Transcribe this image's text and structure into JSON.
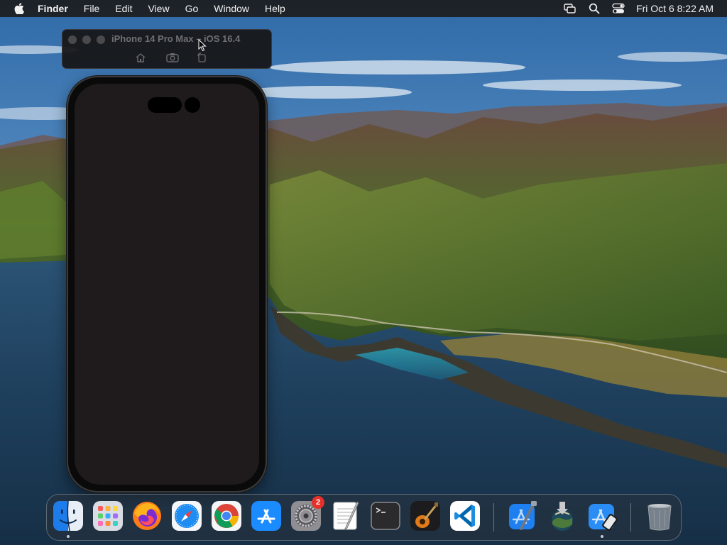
{
  "menubar": {
    "app_name": "Finder",
    "items": [
      "File",
      "Edit",
      "View",
      "Go",
      "Window",
      "Help"
    ],
    "clock": "Fri Oct 6  8:22 AM",
    "status_icons": [
      "screen-mirroring-icon",
      "spotlight-search-icon",
      "control-center-icon"
    ]
  },
  "simulator": {
    "title": "iPhone 14 Pro Max – iOS 16.4",
    "buttons": [
      "home-icon",
      "screenshot-icon",
      "rotate-icon"
    ]
  },
  "dock": {
    "apps": [
      {
        "name": "Finder",
        "icon": "finder-icon",
        "running": true
      },
      {
        "name": "Launchpad",
        "icon": "launchpad-icon",
        "running": false
      },
      {
        "name": "Firefox",
        "icon": "firefox-icon",
        "running": false
      },
      {
        "name": "Safari",
        "icon": "safari-icon",
        "running": false
      },
      {
        "name": "Google Chrome",
        "icon": "chrome-icon",
        "running": false
      },
      {
        "name": "App Store",
        "icon": "app-store-icon",
        "running": false
      },
      {
        "name": "System Settings",
        "icon": "system-settings-icon",
        "running": false,
        "badge": "2"
      },
      {
        "name": "TextEdit",
        "icon": "textedit-icon",
        "running": false
      },
      {
        "name": "Terminal",
        "icon": "terminal-icon",
        "running": false
      },
      {
        "name": "GarageBand",
        "icon": "garageband-icon",
        "running": false
      },
      {
        "name": "Visual Studio Code",
        "icon": "vscode-icon",
        "running": false
      },
      {
        "name": "Xcode",
        "icon": "xcode-icon",
        "running": false
      },
      {
        "name": "macOS Installer",
        "icon": "installer-icon",
        "running": false
      },
      {
        "name": "Simulator",
        "icon": "simulator-icon",
        "running": true
      },
      {
        "name": "Trash",
        "icon": "trash-icon",
        "running": false
      }
    ]
  },
  "colors": {
    "menubar_bg": "#1c1c1e",
    "badge": "#e5312a",
    "device_screen": "#1f1b1c"
  }
}
